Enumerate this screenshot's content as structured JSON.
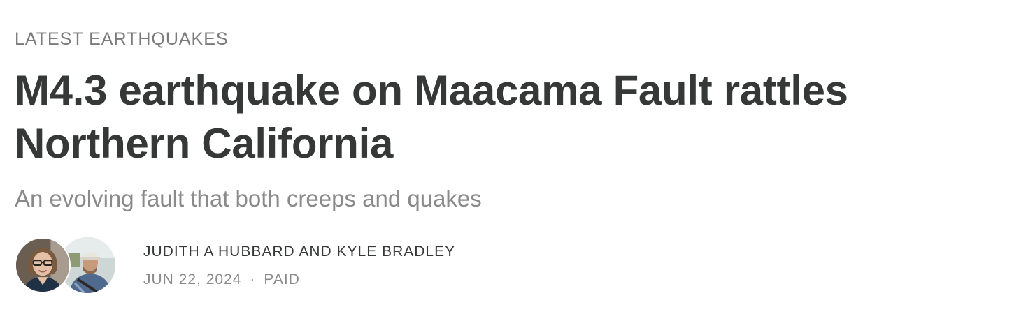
{
  "section": {
    "label": "LATEST EARTHQUAKES"
  },
  "post": {
    "title": "M4.3 earthquake on Maacama Fault rattles Northern California",
    "subtitle": "An evolving fault that both creeps and quakes"
  },
  "byline": {
    "authors": "JUDITH A HUBBARD AND KYLE BRADLEY",
    "date": "JUN 22, 2024",
    "separator": "·",
    "access": "PAID",
    "avatars": [
      {
        "icon": "author-photo-judith-hubbard"
      },
      {
        "icon": "author-photo-kyle-bradley"
      }
    ]
  },
  "colors": {
    "text_primary": "#363737",
    "text_secondary": "#8a8a8a",
    "background": "#ffffff"
  }
}
